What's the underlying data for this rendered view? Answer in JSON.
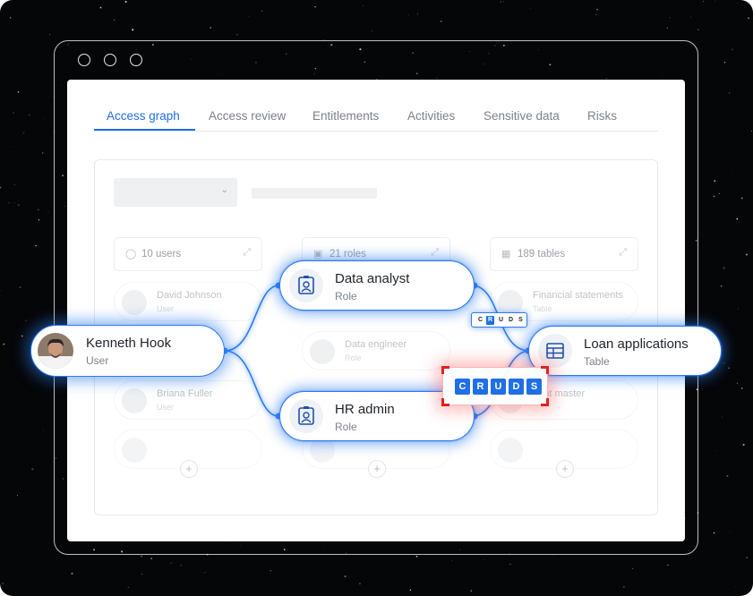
{
  "tabs": [
    {
      "label": "Access graph",
      "active": true
    },
    {
      "label": "Access review"
    },
    {
      "label": "Entitlements"
    },
    {
      "label": "Activities"
    },
    {
      "label": "Sensitive data"
    },
    {
      "label": "Risks"
    }
  ],
  "columns": {
    "users": "10 users",
    "roles": "21 roles",
    "tables": "189 tables"
  },
  "ghost_items": {
    "david": {
      "title": "David Johnson",
      "sub": "User"
    },
    "financial": {
      "title": "Financial statements",
      "sub": "Table"
    },
    "data_engineer": {
      "title": "Data engineer",
      "sub": "Role"
    },
    "briana": {
      "title": "Briana Fuller",
      "sub": "User"
    },
    "account_master": {
      "title": "ount master",
      "sub": ""
    }
  },
  "nodes": {
    "user": {
      "title": "Kenneth Hook",
      "sub": "User"
    },
    "data_analyst": {
      "title": "Data analyst",
      "sub": "Role"
    },
    "hr_admin": {
      "title": "HR admin",
      "sub": "Role"
    },
    "loan_apps": {
      "title": "Loan applications",
      "sub": "Table"
    }
  },
  "permissions": {
    "letters": [
      "C",
      "R",
      "U",
      "D",
      "S"
    ],
    "data_analyst_active": [
      "R"
    ],
    "hr_admin_active": [
      "C",
      "R",
      "U",
      "D",
      "S"
    ]
  },
  "plus_symbol": "+",
  "colors": {
    "accent": "#1f6fe5",
    "highlight": "#e4201f",
    "background": "#050608"
  }
}
